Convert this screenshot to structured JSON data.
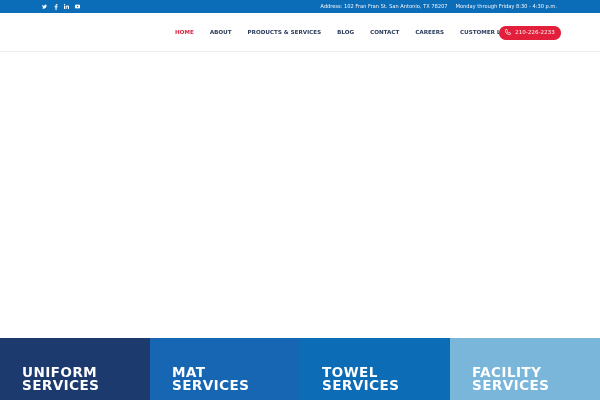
{
  "topbar": {
    "social": [
      "twitter-icon",
      "facebook-icon",
      "linkedin-icon",
      "youtube-icon"
    ],
    "address": "Address: 102 Fran Fran St. San Antonio, TX 78207",
    "hours": "Monday through Friday 8:30 - 4:30 p.m."
  },
  "nav": {
    "items": [
      {
        "label": "HOME",
        "active": true
      },
      {
        "label": "ABOUT",
        "active": false
      },
      {
        "label": "PRODUCTS & SERVICES",
        "active": false
      },
      {
        "label": "BLOG",
        "active": false
      },
      {
        "label": "CONTACT",
        "active": false
      },
      {
        "label": "CAREERS",
        "active": false
      },
      {
        "label": "CUSTOMER LOGIN",
        "active": false
      }
    ],
    "phone": "210-226-2233"
  },
  "services": [
    {
      "line1": "UNIFORM",
      "line2": "SERVICES",
      "color": "#1d3a6e"
    },
    {
      "line1": "MAT",
      "line2": "SERVICES",
      "color": "#1666b4"
    },
    {
      "line1": "TOWEL",
      "line2": "SERVICES",
      "color": "#0c6cb6"
    },
    {
      "line1": "FACILITY",
      "line2": "SERVICES",
      "color": "#7ab6da"
    }
  ],
  "colors": {
    "topbar": "#0b6cb8",
    "accent": "#e2203b",
    "nav_text": "#2a3a5a"
  }
}
